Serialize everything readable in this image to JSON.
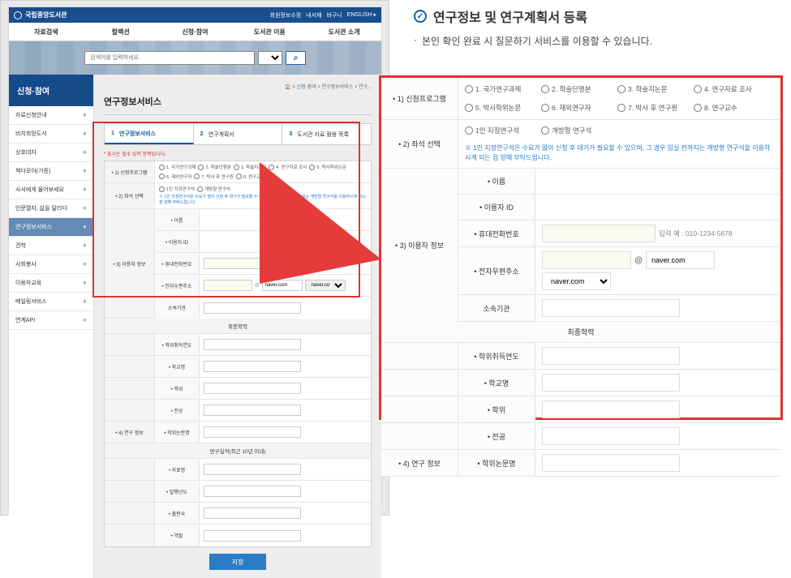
{
  "callout": {
    "title": "연구정보 및 연구계획서 등록",
    "desc": "본인 확인 완료 시 질문하기 서비스를 이용할 수 있습니다."
  },
  "brand": "국립중앙도서관",
  "toplinks": [
    "회원정보수정",
    "내서재",
    "바구니",
    "ENGLISH ▸"
  ],
  "nav": [
    "자료검색",
    "컬렉션",
    "신청·참여",
    "도서관 이용",
    "도서관 소개"
  ],
  "search": {
    "placeholder": "검색어를 입력하세요."
  },
  "crumb": "🏠 > 신청·참여 > 연구정보서비스 > 연구...",
  "side_head": "신청·참여",
  "side": [
    {
      "label": "자료신청안내"
    },
    {
      "label": "비치희망도서"
    },
    {
      "label": "상호대차"
    },
    {
      "label": "책다모아(기증)"
    },
    {
      "label": "사서에게 물어보세요"
    },
    {
      "label": "인문열차, 삶을 달리다"
    },
    {
      "label": "연구정보서비스",
      "active": true
    },
    {
      "label": "견학"
    },
    {
      "label": "사회봉사"
    },
    {
      "label": "이용자교육"
    },
    {
      "label": "메일링서비스"
    },
    {
      "label": "연계API"
    }
  ],
  "page_title": "연구정보서비스",
  "tabs": [
    {
      "num": "1",
      "label": "연구정보서비스",
      "active": true
    },
    {
      "num": "2",
      "label": "연구계획서"
    },
    {
      "num": "3",
      "label": "도서관 자료 활용 목록"
    }
  ],
  "req_note": "* 표시는 필수 입력 항목입니다.",
  "heads": {
    "program": "• 1) 신청프로그램",
    "seat": "• 2) 좌석 선택",
    "user": "• 3) 이용자 정보",
    "research": "• 4) 연구 정보"
  },
  "subheads": {
    "name": "• 이름",
    "userid": "• 이용자 ID",
    "phone": "• 휴대전화번호",
    "email": "• 전자우편주소",
    "org": "소속기관",
    "final_edu": "최종학력",
    "degree_year": "• 학위취득연도",
    "school": "• 학교명",
    "degree": "• 학위",
    "major": "• 전공",
    "thesis": "• 학위논문명",
    "recent_research": "연구실적(최근 10년 이내)",
    "employer": "• 자료명",
    "published": "• 발행년도",
    "publisher": "• 출판사",
    "role": "• 역할"
  },
  "options": {
    "programs": [
      "1. 국가연구과제",
      "2. 학술단행본",
      "3. 학술지논문",
      "4. 연구자료 조사",
      "5. 박사학위논문",
      "6. 재외연구자",
      "7. 박사 후 연구원",
      "8. 연구교수"
    ],
    "seats": [
      "1인 지정연구석",
      "개방형 연구석"
    ],
    "seat_note": "※ 1인 지정연구석은 수요가 많아 신청 후 대기가 필요할 수 있으며, 그 경우 입실 전까지는 개방형 연구석을 이용하시게 되는 점 양해 부탁드립니다."
  },
  "phone_hint": "입력 예 : 010-1234-5678",
  "email": {
    "default": "naver.com",
    "select": "naver.com"
  },
  "save": "저장"
}
